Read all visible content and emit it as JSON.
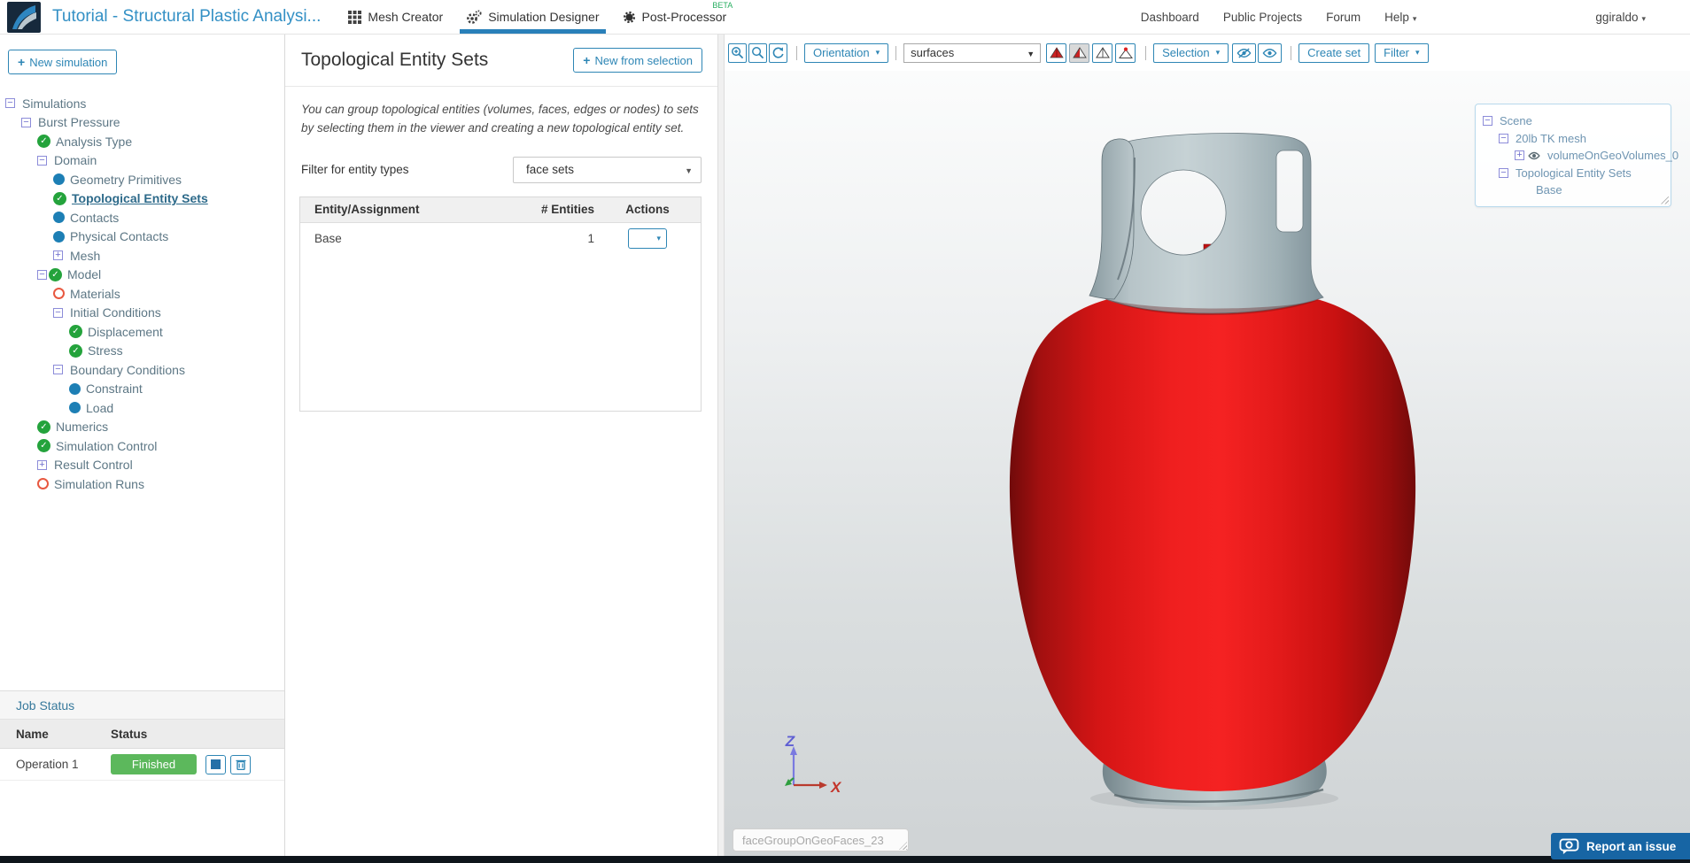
{
  "navbar": {
    "title": "Tutorial - Structural Plastic Analysi...",
    "tabs": [
      {
        "label": "Mesh Creator"
      },
      {
        "label": "Simulation Designer",
        "active": true
      },
      {
        "label": "Post-Processor",
        "beta": "BETA"
      }
    ],
    "links": [
      "Dashboard",
      "Public Projects",
      "Forum"
    ],
    "help": "Help",
    "user": "ggiraldo"
  },
  "sidebar": {
    "new_button": "New simulation",
    "tree": [
      {
        "label": "Simulations",
        "icon": "collapse",
        "level": 0
      },
      {
        "label": "Burst Pressure",
        "icon": "collapse",
        "level": 1
      },
      {
        "label": "Analysis Type",
        "icon": "check",
        "level": 2
      },
      {
        "label": "Domain",
        "icon": "collapse",
        "level": 2
      },
      {
        "label": "Geometry Primitives",
        "icon": "dot",
        "level": 3
      },
      {
        "label": "Topological Entity Sets",
        "icon": "check",
        "level": 3,
        "selected": true
      },
      {
        "label": "Contacts",
        "icon": "dot",
        "level": 3
      },
      {
        "label": "Physical Contacts",
        "icon": "dot",
        "level": 3
      },
      {
        "label": "Mesh",
        "icon": "expand",
        "level": 3
      },
      {
        "label": "Model",
        "icon": "collapse+check",
        "level": 2
      },
      {
        "label": "Materials",
        "icon": "ring",
        "level": 3
      },
      {
        "label": "Initial Conditions",
        "icon": "collapse",
        "level": 3
      },
      {
        "label": "Displacement",
        "icon": "check",
        "level": 4
      },
      {
        "label": "Stress",
        "icon": "check",
        "level": 4
      },
      {
        "label": "Boundary Conditions",
        "icon": "collapse",
        "level": 3
      },
      {
        "label": "Constraint",
        "icon": "dot",
        "level": 4
      },
      {
        "label": "Load",
        "icon": "dot",
        "level": 4
      },
      {
        "label": "Numerics",
        "icon": "check",
        "level": 2
      },
      {
        "label": "Simulation Control",
        "icon": "check",
        "level": 2
      },
      {
        "label": "Result Control",
        "icon": "expand",
        "level": 2
      },
      {
        "label": "Simulation Runs",
        "icon": "ring",
        "level": 2
      }
    ],
    "job_status": {
      "title": "Job Status",
      "columns": [
        "Name",
        "Status"
      ],
      "rows": [
        {
          "name": "Operation 1",
          "status": "Finished"
        }
      ]
    }
  },
  "panel": {
    "title": "Topological Entity Sets",
    "new_button": "New from selection",
    "description": "You can group topological entities (volumes, faces, edges or nodes) to sets by selecting them in the viewer and creating a new topological entity set.",
    "filter_label": "Filter for entity types",
    "filter_value": "face sets",
    "table": {
      "headers": [
        "Entity/Assignment",
        "# Entities",
        "Actions"
      ],
      "rows": [
        {
          "entity": "Base",
          "count": "1"
        }
      ]
    }
  },
  "viewer": {
    "toolbar": {
      "orientation": "Orientation",
      "render_mode": "surfaces",
      "selection": "Selection",
      "create_set": "Create set",
      "filter": "Filter"
    },
    "scene_tree": [
      {
        "label": "Scene",
        "icon": "collapse",
        "level": 0
      },
      {
        "label": "20lb TK mesh",
        "icon": "collapse",
        "level": 1
      },
      {
        "label": "volumeOnGeoVolumes_0",
        "icon": "expand+eye",
        "level": 2
      },
      {
        "label": "Topological Entity Sets",
        "icon": "collapse",
        "level": 1
      },
      {
        "label": "Base",
        "icon": "none",
        "level": 2
      }
    ],
    "axis": {
      "x": "X",
      "z": "Z"
    },
    "selection_input": "faceGroupOnGeoFaces_23",
    "report_button": "Report an issue"
  },
  "colors": {
    "accent": "#2e86b5",
    "tab_underline": "#2980b9",
    "link_blue": "#3390c5",
    "finished_badge": "#5cb85c",
    "tank_red": "#e01515",
    "tank_gray": "#aebcc0"
  }
}
